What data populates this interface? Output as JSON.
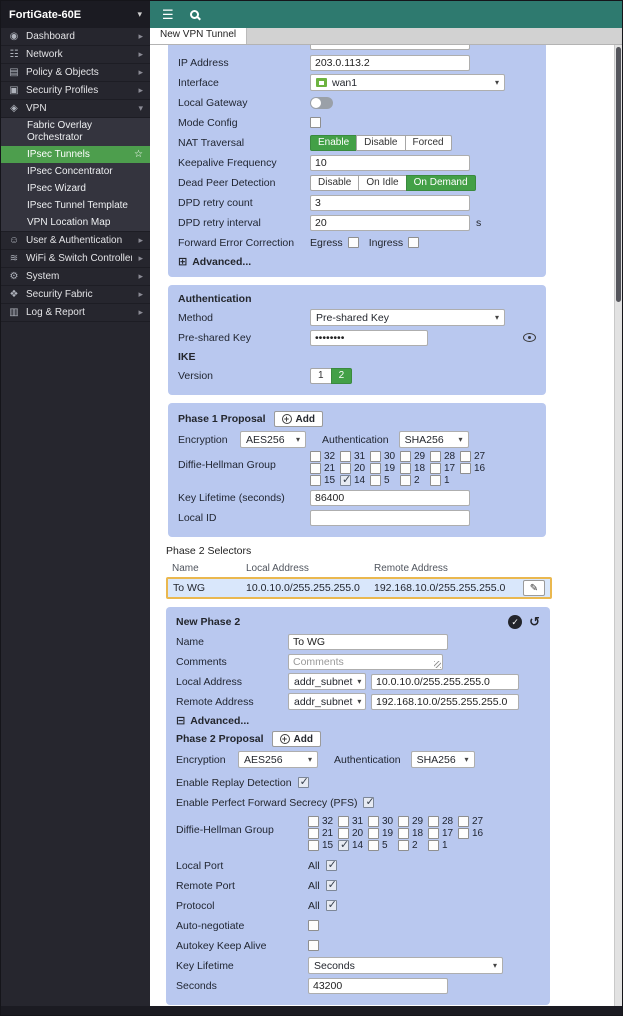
{
  "app": {
    "device_name": "FortiGate-60E",
    "tab": "New VPN Tunnel"
  },
  "icons": {
    "hamburger": "☰",
    "caret_down": "▾",
    "chevron_right": "▸",
    "star": "☆",
    "advanced_collapsed": "⊞",
    "advanced_expanded": "⊟",
    "pencil": "✎",
    "undo": "↺",
    "check": "✓",
    "plus": "+"
  },
  "colors": {
    "accent_green": "#43a047",
    "panel_blue": "#b9c8ef",
    "header_teal": "#2e7a6f",
    "selected_row_border": "#eab84f"
  },
  "sidebar": {
    "items": [
      {
        "label": "Dashboard",
        "glyph": "◉"
      },
      {
        "label": "Network",
        "glyph": "☷"
      },
      {
        "label": "Policy & Objects",
        "glyph": "▤"
      },
      {
        "label": "Security Profiles",
        "glyph": "▣"
      },
      {
        "label": "VPN",
        "glyph": "◈"
      },
      {
        "label": "User & Authentication",
        "glyph": "☺"
      },
      {
        "label": "WiFi & Switch Controller",
        "glyph": "≋"
      },
      {
        "label": "System",
        "glyph": "⚙"
      },
      {
        "label": "Security Fabric",
        "glyph": "❖"
      },
      {
        "label": "Log & Report",
        "glyph": "▥"
      }
    ],
    "vpn_submenu": [
      {
        "label": "Fabric Overlay Orchestrator"
      },
      {
        "label": "IPsec Tunnels",
        "active": true
      },
      {
        "label": "IPsec Concentrator"
      },
      {
        "label": "IPsec Wizard"
      },
      {
        "label": "IPsec Tunnel Template"
      },
      {
        "label": "VPN Location Map"
      }
    ]
  },
  "network": {
    "ip_address": {
      "label": "IP Address",
      "value": "203.0.113.2"
    },
    "interface": {
      "label": "Interface",
      "value": "wan1"
    },
    "local_gateway": {
      "label": "Local Gateway",
      "enabled": false
    },
    "mode_config": {
      "label": "Mode Config",
      "checked": false
    },
    "nat_traversal": {
      "label": "NAT Traversal",
      "options": [
        "Enable",
        "Disable",
        "Forced"
      ],
      "selected": "Enable"
    },
    "keepalive": {
      "label": "Keepalive Frequency",
      "value": "10"
    },
    "dpd": {
      "label": "Dead Peer Detection",
      "options": [
        "Disable",
        "On Idle",
        "On Demand"
      ],
      "selected": "On Demand"
    },
    "dpd_retry_count": {
      "label": "DPD retry count",
      "value": "3"
    },
    "dpd_retry_interval": {
      "label": "DPD retry interval",
      "value": "20",
      "unit": "s"
    },
    "fec": {
      "label": "Forward Error Correction",
      "egress_label": "Egress",
      "egress_checked": false,
      "ingress_label": "Ingress",
      "ingress_checked": false
    },
    "advanced_label": "Advanced..."
  },
  "authentication": {
    "header": "Authentication",
    "method": {
      "label": "Method",
      "value": "Pre-shared Key"
    },
    "preshared_key": {
      "label": "Pre-shared Key",
      "value": "••••••••"
    },
    "ike_header": "IKE",
    "version": {
      "label": "Version",
      "options": [
        "1",
        "2"
      ],
      "selected": "2"
    }
  },
  "phase1": {
    "header": "Phase 1 Proposal",
    "add_label": "Add",
    "encryption": {
      "label": "Encryption",
      "value": "AES256"
    },
    "authentication": {
      "label": "Authentication",
      "value": "SHA256"
    },
    "dh": {
      "label": "Diffie-Hellman Group",
      "rows": [
        [
          {
            "n": "32",
            "c": false
          },
          {
            "n": "31",
            "c": false
          },
          {
            "n": "30",
            "c": false
          },
          {
            "n": "29",
            "c": false
          },
          {
            "n": "28",
            "c": false
          },
          {
            "n": "27",
            "c": false
          }
        ],
        [
          {
            "n": "21",
            "c": false
          },
          {
            "n": "20",
            "c": false
          },
          {
            "n": "19",
            "c": false
          },
          {
            "n": "18",
            "c": false
          },
          {
            "n": "17",
            "c": false
          },
          {
            "n": "16",
            "c": false
          }
        ],
        [
          {
            "n": "15",
            "c": false
          },
          {
            "n": "14",
            "c": true
          },
          {
            "n": "5",
            "c": false
          },
          {
            "n": "2",
            "c": false
          },
          {
            "n": "1",
            "c": false
          }
        ]
      ]
    },
    "key_lifetime": {
      "label": "Key Lifetime (seconds)",
      "value": "86400"
    },
    "local_id": {
      "label": "Local ID",
      "value": ""
    }
  },
  "phase2_selectors": {
    "title": "Phase 2 Selectors",
    "headers": [
      "Name",
      "Local Address",
      "Remote Address"
    ],
    "rows": [
      {
        "name": "To WG",
        "local": "10.0.10.0/255.255.255.0",
        "remote": "192.168.10.0/255.255.255.0"
      }
    ]
  },
  "new_phase2": {
    "header": "New Phase 2",
    "name": {
      "label": "Name",
      "value": "To WG"
    },
    "comments": {
      "label": "Comments",
      "placeholder": "Comments"
    },
    "local_address": {
      "label": "Local Address",
      "type": "addr_subnet",
      "value": "10.0.10.0/255.255.255.0"
    },
    "remote_address": {
      "label": "Remote Address",
      "type": "addr_subnet",
      "value": "192.168.10.0/255.255.255.0"
    },
    "advanced_label": "Advanced...",
    "proposal_header": "Phase 2 Proposal",
    "add_label": "Add",
    "encryption": {
      "label": "Encryption",
      "value": "AES256"
    },
    "authentication": {
      "label": "Authentication",
      "value": "SHA256"
    },
    "replay": {
      "label": "Enable Replay Detection",
      "checked": true
    },
    "pfs": {
      "label": "Enable Perfect Forward Secrecy (PFS)",
      "checked": true
    },
    "dh": {
      "label": "Diffie-Hellman Group",
      "rows": [
        [
          {
            "n": "32",
            "c": false
          },
          {
            "n": "31",
            "c": false
          },
          {
            "n": "30",
            "c": false
          },
          {
            "n": "29",
            "c": false
          },
          {
            "n": "28",
            "c": false
          },
          {
            "n": "27",
            "c": false
          }
        ],
        [
          {
            "n": "21",
            "c": false
          },
          {
            "n": "20",
            "c": false
          },
          {
            "n": "19",
            "c": false
          },
          {
            "n": "18",
            "c": false
          },
          {
            "n": "17",
            "c": false
          },
          {
            "n": "16",
            "c": false
          }
        ],
        [
          {
            "n": "15",
            "c": false
          },
          {
            "n": "14",
            "c": true
          },
          {
            "n": "5",
            "c": false
          },
          {
            "n": "2",
            "c": false
          },
          {
            "n": "1",
            "c": false
          }
        ]
      ]
    },
    "local_port": {
      "label": "Local Port",
      "all_label": "All",
      "checked": true
    },
    "remote_port": {
      "label": "Remote Port",
      "all_label": "All",
      "checked": true
    },
    "protocol": {
      "label": "Protocol",
      "all_label": "All",
      "checked": true
    },
    "auto_negotiate": {
      "label": "Auto-negotiate",
      "checked": false
    },
    "autokey": {
      "label": "Autokey Keep Alive",
      "checked": false
    },
    "key_lifetime": {
      "label": "Key Lifetime",
      "value": "Seconds"
    },
    "seconds": {
      "label": "Seconds",
      "value": "43200"
    }
  }
}
